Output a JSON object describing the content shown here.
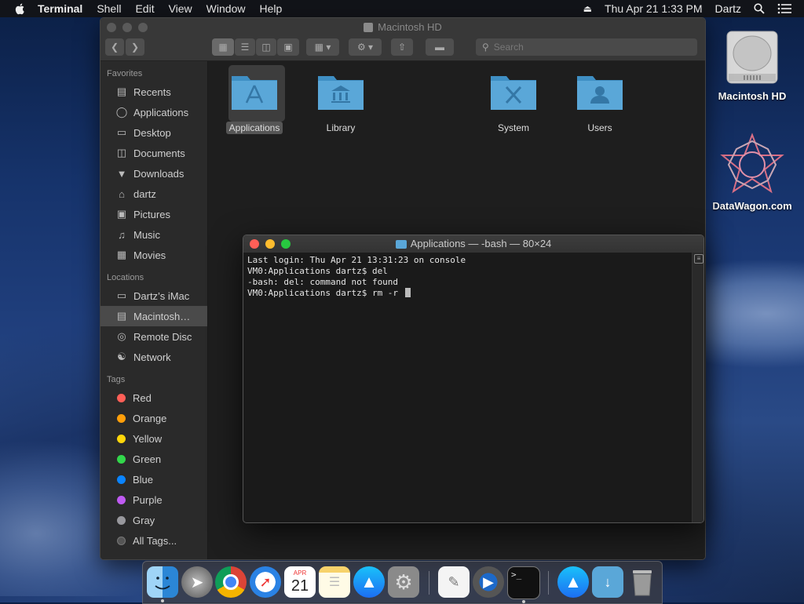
{
  "menubar": {
    "app": "Terminal",
    "items": [
      "Shell",
      "Edit",
      "View",
      "Window",
      "Help"
    ],
    "datetime": "Thu Apr 21  1:33 PM",
    "user": "Dartz"
  },
  "finder": {
    "title": "Macintosh HD",
    "search_placeholder": "Search",
    "sidebar": {
      "favorites_label": "Favorites",
      "favorites": [
        "Recents",
        "Applications",
        "Desktop",
        "Documents",
        "Downloads",
        "dartz",
        "Pictures",
        "Music",
        "Movies"
      ],
      "locations_label": "Locations",
      "locations": [
        "Dartz’s iMac",
        "Macintosh…",
        "Remote Disc",
        "Network"
      ],
      "tags_label": "Tags",
      "tags": [
        {
          "name": "Red",
          "color": "#ff5f57"
        },
        {
          "name": "Orange",
          "color": "#ff9f0a"
        },
        {
          "name": "Yellow",
          "color": "#ffd60a"
        },
        {
          "name": "Green",
          "color": "#32d74b"
        },
        {
          "name": "Blue",
          "color": "#0a84ff"
        },
        {
          "name": "Purple",
          "color": "#bf5af2"
        },
        {
          "name": "Gray",
          "color": "#98989d"
        },
        {
          "name": "All Tags...",
          "color": "#555555"
        }
      ]
    },
    "folders": [
      "Applications",
      "Library",
      "System",
      "Users"
    ]
  },
  "terminal": {
    "title": "Applications — -bash — 80×24",
    "lines": [
      "Last login: Thu Apr 21 13:31:23 on console",
      "VM0:Applications dartz$ del",
      "-bash: del: command not found",
      "VM0:Applications dartz$ rm -r "
    ]
  },
  "desktop": {
    "icons": [
      "Macintosh HD",
      "DataWagon.com"
    ]
  },
  "dock": {
    "apps": [
      "Finder",
      "Launchpad",
      "Chrome",
      "Safari",
      "Calendar",
      "Notes",
      "App Store",
      "System Preferences",
      "TextEdit",
      "QuickTime Player",
      "Terminal",
      "App Store Downloads",
      "Applications folder",
      "Trash"
    ],
    "calendar_month": "APR",
    "calendar_day": "21"
  },
  "colors": {
    "folder": "#5aa7d8",
    "accent": "#0a84ff"
  }
}
